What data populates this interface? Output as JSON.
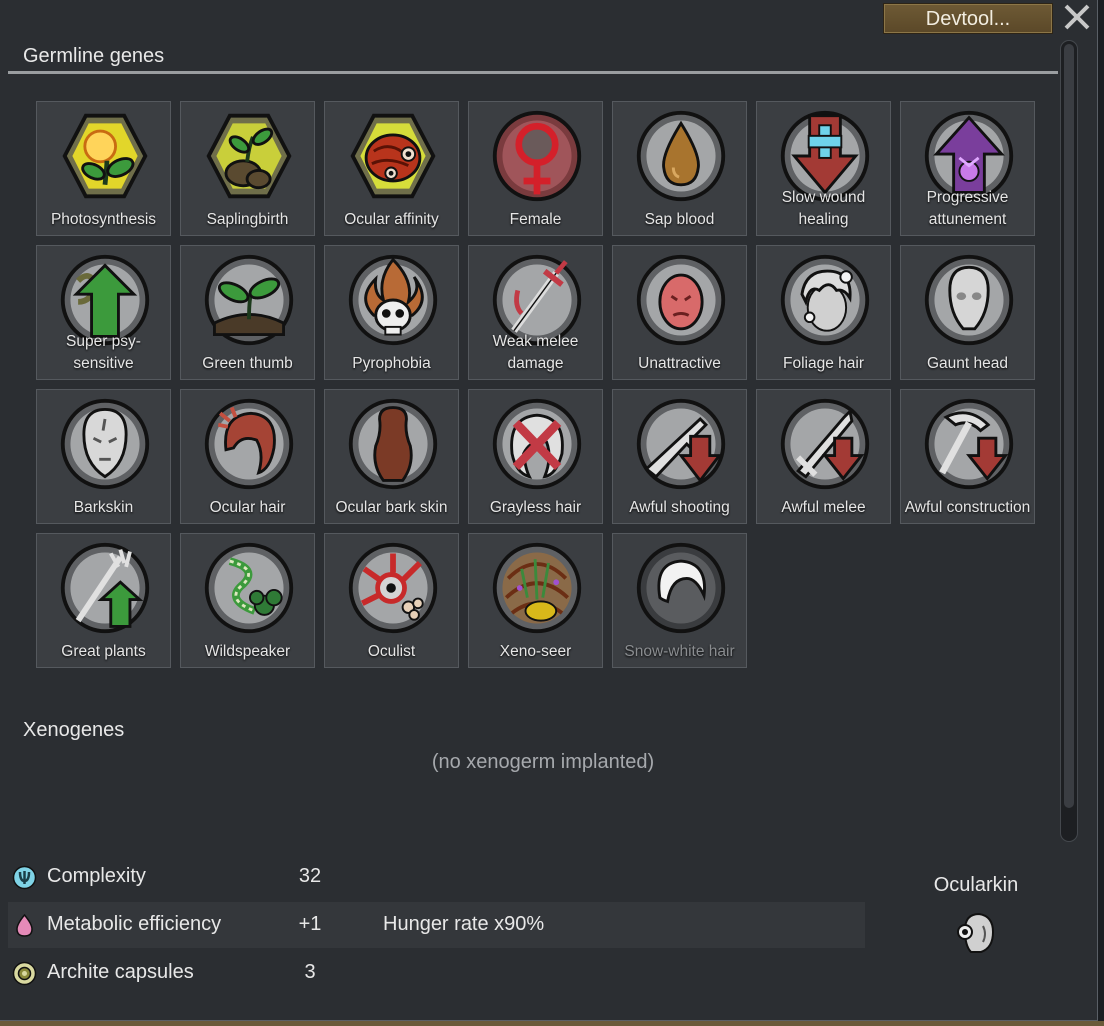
{
  "header": {
    "devtool_label": "Devtool..."
  },
  "germline": {
    "title": "Germline genes",
    "genes": [
      {
        "label": "Photosynthesis",
        "icon": "photosynthesis-icon"
      },
      {
        "label": "Saplingbirth",
        "icon": "saplingbirth-icon"
      },
      {
        "label": "Ocular affinity",
        "icon": "ocular-affinity-icon"
      },
      {
        "label": "Female",
        "icon": "female-icon"
      },
      {
        "label": "Sap blood",
        "icon": "sap-blood-icon"
      },
      {
        "label": "Slow wound healing",
        "icon": "slow-wound-healing-icon"
      },
      {
        "label": "Progressive attunement",
        "icon": "progressive-attunement-icon"
      },
      {
        "label": "Super psy-sensitive",
        "icon": "super-psy-sensitive-icon"
      },
      {
        "label": "Green thumb",
        "icon": "green-thumb-icon"
      },
      {
        "label": "Pyrophobia",
        "icon": "pyrophobia-icon"
      },
      {
        "label": "Weak melee damage",
        "icon": "weak-melee-damage-icon"
      },
      {
        "label": "Unattractive",
        "icon": "unattractive-icon"
      },
      {
        "label": "Foliage hair",
        "icon": "foliage-hair-icon"
      },
      {
        "label": "Gaunt head",
        "icon": "gaunt-head-icon"
      },
      {
        "label": "Barkskin",
        "icon": "barkskin-icon"
      },
      {
        "label": "Ocular hair",
        "icon": "ocular-hair-icon"
      },
      {
        "label": "Ocular bark skin",
        "icon": "ocular-bark-skin-icon"
      },
      {
        "label": "Grayless hair",
        "icon": "grayless-hair-icon"
      },
      {
        "label": "Awful shooting",
        "icon": "awful-shooting-icon"
      },
      {
        "label": "Awful melee",
        "icon": "awful-melee-icon"
      },
      {
        "label": "Awful construction",
        "icon": "awful-construction-icon"
      },
      {
        "label": "Great plants",
        "icon": "great-plants-icon"
      },
      {
        "label": "Wildspeaker",
        "icon": "wildspeaker-icon"
      },
      {
        "label": "Oculist",
        "icon": "oculist-icon"
      },
      {
        "label": "Xeno-seer",
        "icon": "xeno-seer-icon"
      },
      {
        "label": "Snow-white hair",
        "icon": "snow-white-hair-icon"
      }
    ]
  },
  "xenogenes": {
    "title": "Xenogenes",
    "empty_text": "(no xenogerm implanted)"
  },
  "stats": {
    "complexity": {
      "label": "Complexity",
      "value": "32"
    },
    "metabolic": {
      "label": "Metabolic efficiency",
      "value": "+1",
      "note": "Hunger rate x90%"
    },
    "archite": {
      "label": "Archite capsules",
      "value": "3"
    }
  },
  "xenotype": {
    "name": "Ocularkin",
    "icon": "ocularkin-icon"
  },
  "colors": {
    "window_bg": "#2b2e32",
    "tile_bg": "#3b3e42",
    "complexity_icon": "#7fd3e6",
    "metabolic_icon": "#e58ab8",
    "archite_icon": "#d9d9a0",
    "devtool_btn": "#5b4828"
  }
}
